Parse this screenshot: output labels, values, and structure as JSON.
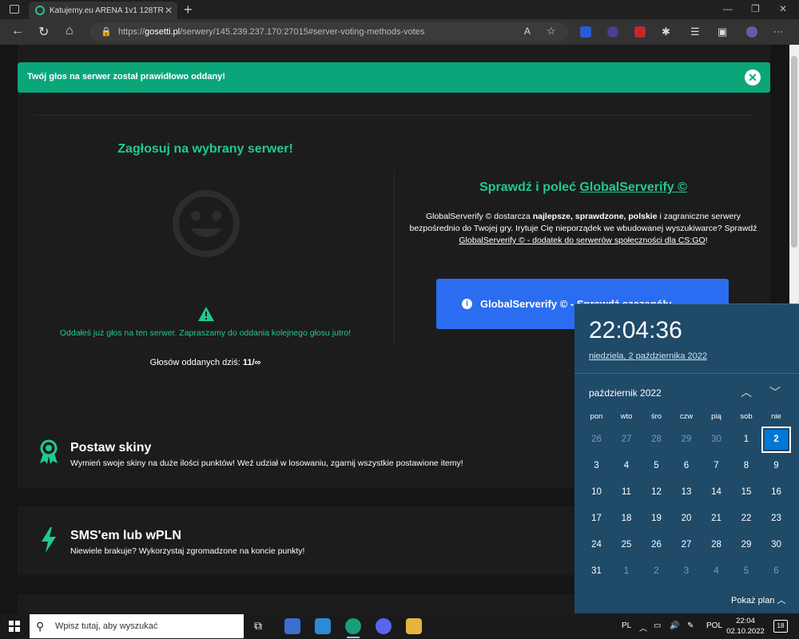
{
  "browser": {
    "tab_title": "Katujemy.eu ARENA 1v1 128TR",
    "tab_close": "✕",
    "new_tab": "+",
    "url_prefix": "https://",
    "url_host": "gosetti.pl",
    "url_path": "/serwery/145.239.237.170:27015#server-voting-methods-votes",
    "read_aloud": "A",
    "menu": "···"
  },
  "toast": {
    "message": "Twój głos na serwer został prawidłowo oddany!",
    "close": "✕"
  },
  "vote": {
    "title": "Zagłosuj na wybrany serwer!",
    "already_voted": "Oddałeś już głos na ten serwer. Zapraszamy do oddania kolejnego głosu jutro!",
    "votes_today_label": "Głosów oddanych dziś:",
    "votes_today_value": "11/∞"
  },
  "globalserverify": {
    "title_prefix": "Sprawdź i poleć ",
    "title_link": "GlobalServerify ©",
    "desc_part1": "GlobalServerify © dostarcza ",
    "desc_bold": "najlepsze, sprawdzone, polskie",
    "desc_part2": " i zagraniczne serwery bezpośrednio do Twojej gry. Irytuje Cię nieporządek we wbudowanej wyszukiwarce? Sprawdź ",
    "desc_link": "GlobalServerify © - dodatek do serwerów społeczności dla CS:GO",
    "desc_end": "!",
    "button_label": "GlobalServerify © - Sprawdź szczegóły",
    "info_icon": "i"
  },
  "features": [
    {
      "title": "Postaw skiny",
      "desc": "Wymień swoje skiny na duże ilości punktów! Weź udział w losowaniu, zgarnij wszystkie postawione itemy!"
    },
    {
      "title": "SMS'em lub wPLN",
      "desc": "Niewiele brakuje? Wykorzystaj zgromadzone na koncie punkty!"
    }
  ],
  "calendar": {
    "time": "22:04:36",
    "date_long": "niedziela, 2 października 2022",
    "month": "październik 2022",
    "up": "︿",
    "down": "﹀",
    "weekdays": [
      "pon",
      "wto",
      "śro",
      "czw",
      "pią",
      "sob",
      "nie"
    ],
    "days": [
      [
        "26",
        "27",
        "28",
        "29",
        "30",
        "1",
        "2"
      ],
      [
        "3",
        "4",
        "5",
        "6",
        "7",
        "8",
        "9"
      ],
      [
        "10",
        "11",
        "12",
        "13",
        "14",
        "15",
        "16"
      ],
      [
        "17",
        "18",
        "19",
        "20",
        "21",
        "22",
        "23"
      ],
      [
        "24",
        "25",
        "26",
        "27",
        "28",
        "29",
        "30"
      ],
      [
        "31",
        "1",
        "2",
        "3",
        "4",
        "5",
        "6"
      ]
    ],
    "show_plan": "Pokaż plan  ︿"
  },
  "taskbar": {
    "search_placeholder": "Wpisz tutaj, aby wyszukać",
    "lang": "PL",
    "lang_code": "POL",
    "time": "22:04",
    "date": "02.10.2022",
    "notifications": "18",
    "tray_up": "︿"
  }
}
